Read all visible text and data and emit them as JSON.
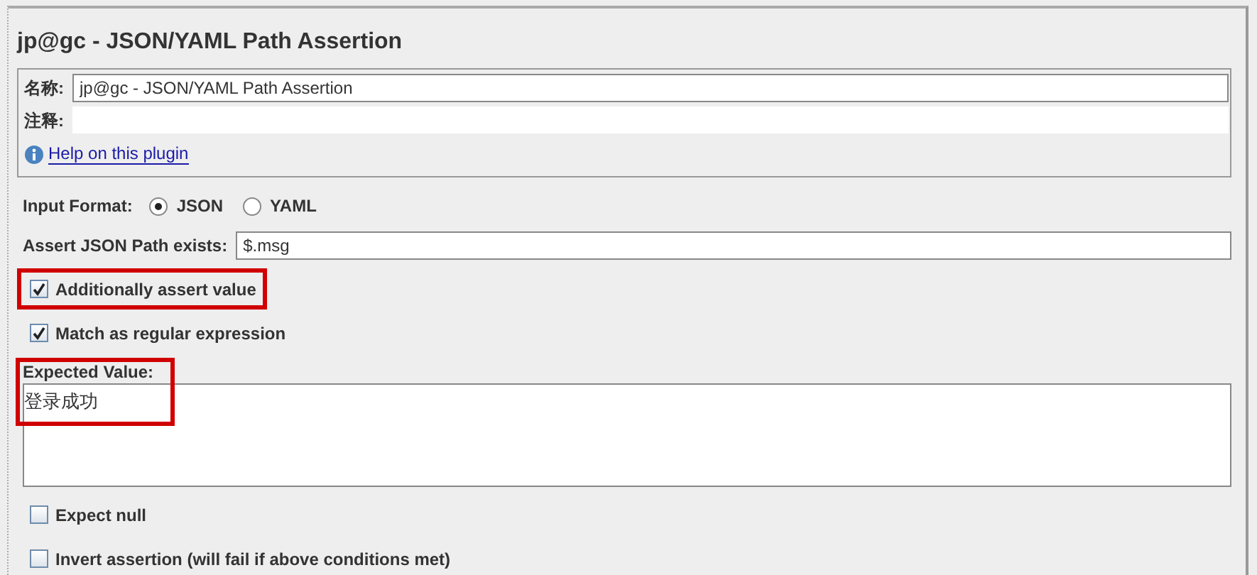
{
  "title": "jp@gc - JSON/YAML Path Assertion",
  "name_panel": {
    "name_label": "名称:",
    "name_value": "jp@gc - JSON/YAML Path Assertion",
    "comment_label": "注释:",
    "help_link": "Help on this plugin"
  },
  "input_format": {
    "label": "Input Format:",
    "options": [
      {
        "label": "JSON",
        "selected": true
      },
      {
        "label": "YAML",
        "selected": false
      }
    ]
  },
  "json_path": {
    "label": "Assert JSON Path exists:",
    "value": "$.msg"
  },
  "options_top": [
    {
      "label": "Additionally assert value",
      "checked": true,
      "highlighted": true
    },
    {
      "label": "Match as regular expression",
      "checked": true,
      "highlighted": false
    }
  ],
  "expected_value": {
    "label": "Expected Value:",
    "value": "登录成功",
    "highlighted": true
  },
  "options_bottom": [
    {
      "label": "Expect null",
      "checked": false,
      "highlighted": false
    },
    {
      "label": "Invert assertion (will fail if above conditions met)",
      "checked": false,
      "highlighted": false
    }
  ]
}
